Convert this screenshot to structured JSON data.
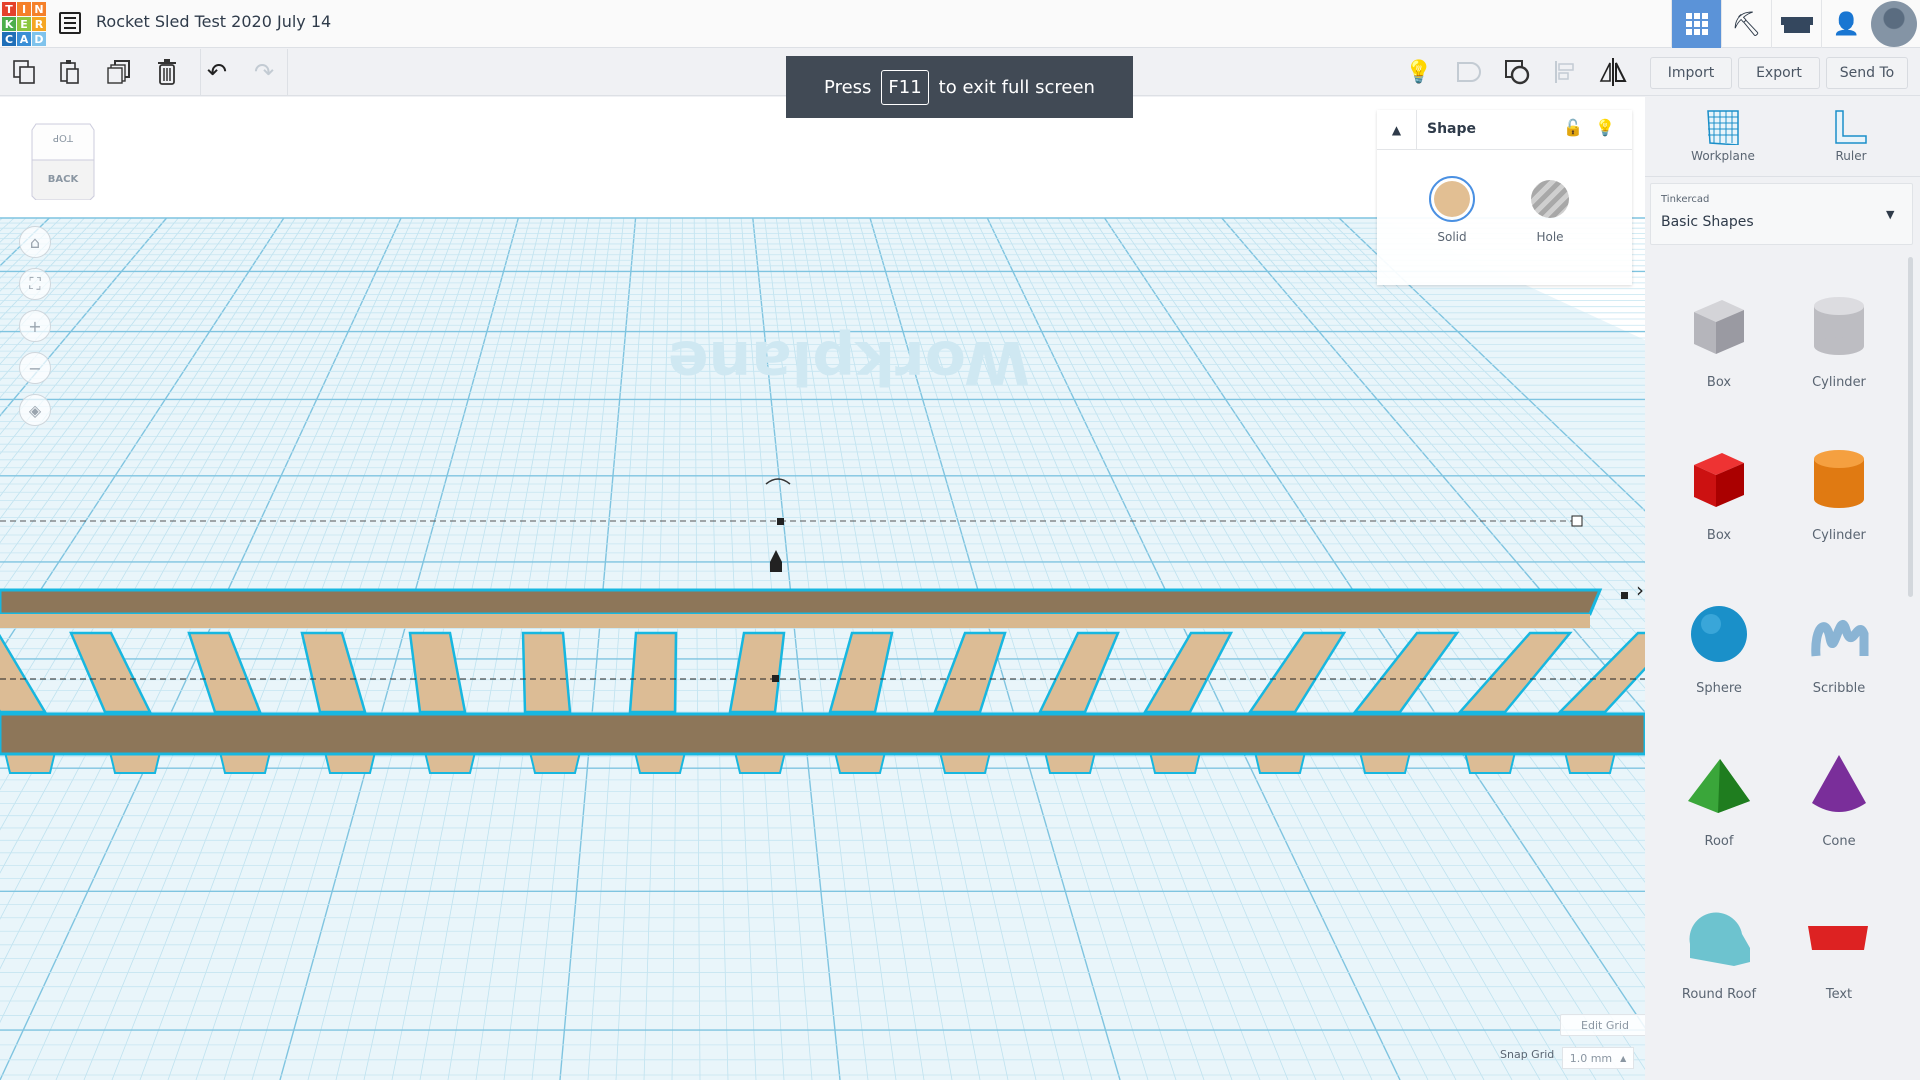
{
  "app": {
    "logo_letters": [
      "T",
      "I",
      "N",
      "K",
      "E",
      "R",
      "C",
      "A",
      "D"
    ],
    "logo_colors": [
      "#e4412b",
      "#f5802a",
      "#f5802a",
      "#4cae4c",
      "#8dc63f",
      "#f5a623",
      "#1f6fb8",
      "#3a8fd6",
      "#7fc3ec"
    ],
    "title": "Rocket Sled Test 2020 July 14"
  },
  "header": {
    "icons": [
      "3d-design-grid-icon",
      "pickaxe-icon",
      "brick-icon",
      "add-user-icon",
      "avatar"
    ],
    "active_color": "#5b93d8"
  },
  "toolbar": {
    "import": "Import",
    "export": "Export",
    "send_to": "Send To"
  },
  "banner": {
    "pre": "Press",
    "key": "F11",
    "post": "to exit full screen"
  },
  "viewcube": {
    "top": "TOP",
    "back": "BACK"
  },
  "workplane": {
    "label": "Workplane",
    "edit_grid": "Edit Grid",
    "snap_grid_label": "Snap Grid",
    "snap_grid_value": "1.0 mm"
  },
  "shape_panel": {
    "title": "Shape",
    "solid": "Solid",
    "hole": "Hole",
    "solid_color": "#e2bf93"
  },
  "right": {
    "workplane": "Workplane",
    "ruler": "Ruler",
    "library_source": "Tinkercad",
    "library": "Basic Shapes",
    "shapes": [
      {
        "label": "Box",
        "kind": "box-hole"
      },
      {
        "label": "Cylinder",
        "kind": "cyl-hole"
      },
      {
        "label": "Box",
        "kind": "box"
      },
      {
        "label": "Cylinder",
        "kind": "cyl"
      },
      {
        "label": "Sphere",
        "kind": "sphere"
      },
      {
        "label": "Scribble",
        "kind": "scribble"
      },
      {
        "label": "Roof",
        "kind": "roof"
      },
      {
        "label": "Cone",
        "kind": "cone"
      },
      {
        "label": "Round Roof",
        "kind": "roundroof"
      },
      {
        "label": "Text",
        "kind": "text"
      }
    ]
  }
}
